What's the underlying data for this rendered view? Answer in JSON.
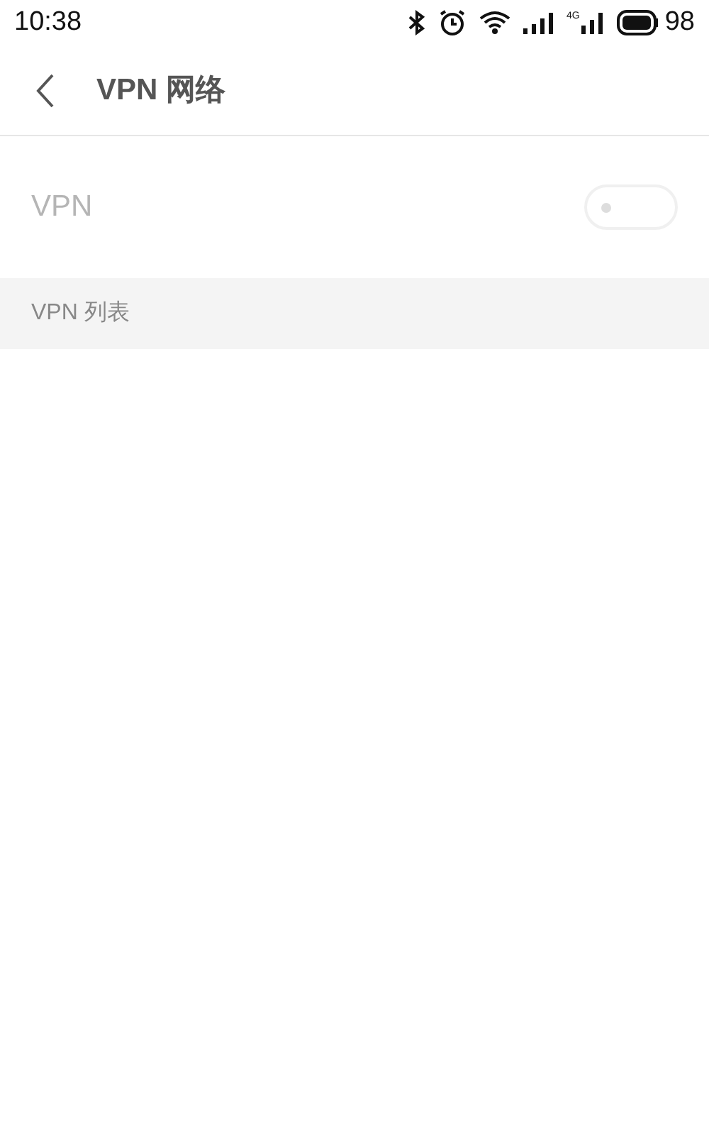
{
  "status_bar": {
    "time": "10:38",
    "network_label": "4G",
    "battery": "98"
  },
  "header": {
    "title": "VPN 网络"
  },
  "vpn_row": {
    "label": "VPN",
    "on": false,
    "disabled": true
  },
  "section": {
    "title": "VPN 列表"
  }
}
